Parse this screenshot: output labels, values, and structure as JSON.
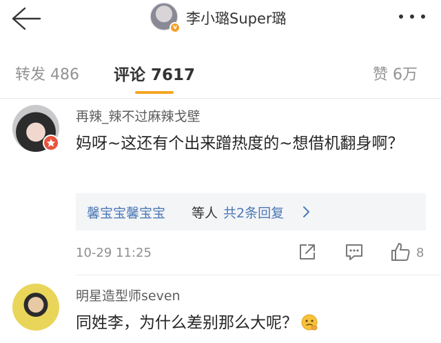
{
  "header": {
    "title": "李小璐Super璐",
    "back_icon": "back-arrow-icon",
    "more_icon": "more-dots-icon",
    "verified_badge": "v"
  },
  "tabs": {
    "repost": "转发 486",
    "comment": "评论 7617",
    "like": "赞 6万",
    "active_color": "#f5a623"
  },
  "comments": [
    {
      "username": "再辣_辣不过麻辣戈壁",
      "text": "妈呀~这还有个出来蹭热度的~想借机翻身啊？",
      "reply": {
        "names": "馨宝宝馨宝宝",
        "suffix": "等人",
        "count": "共2条回复"
      },
      "time": "10-29 11:25",
      "likes": "8"
    },
    {
      "username": "明星造型师seven",
      "text": "同姓李，为什么差别那么大呢？"
    }
  ]
}
